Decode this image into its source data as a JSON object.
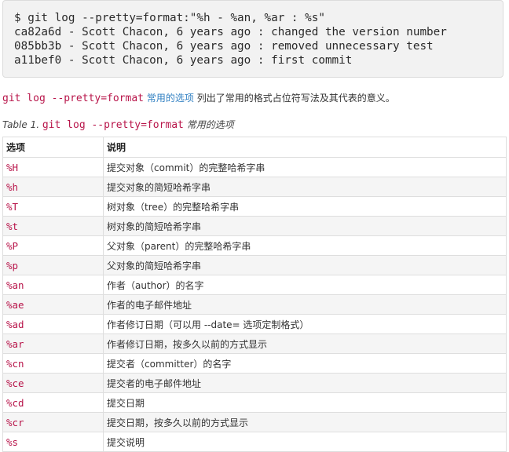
{
  "code_block": {
    "lines": [
      "$ git log --pretty=format:\"%h - %an, %ar : %s\"",
      "ca82a6d - Scott Chacon, 6 years ago : changed the version number",
      "085bb3b - Scott Chacon, 6 years ago : removed unnecessary test",
      "a11bef0 - Scott Chacon, 6 years ago : first commit"
    ]
  },
  "intro": {
    "code": "git log --pretty=format",
    "link": "常用的选项",
    "rest": "列出了常用的格式占位符写法及其代表的意义。"
  },
  "caption": {
    "prefix": "Table 1.",
    "code": "git log --pretty=format",
    "suffix": "常用的选项"
  },
  "table": {
    "headers": [
      "选项",
      "说明"
    ],
    "rows": [
      {
        "option": "%H",
        "desc": "提交对象（commit）的完整哈希字串"
      },
      {
        "option": "%h",
        "desc": "提交对象的简短哈希字串"
      },
      {
        "option": "%T",
        "desc": "树对象（tree）的完整哈希字串"
      },
      {
        "option": "%t",
        "desc": "树对象的简短哈希字串"
      },
      {
        "option": "%P",
        "desc": "父对象（parent）的完整哈希字串"
      },
      {
        "option": "%p",
        "desc": "父对象的简短哈希字串"
      },
      {
        "option": "%an",
        "desc": "作者（author）的名字"
      },
      {
        "option": "%ae",
        "desc": "作者的电子邮件地址"
      },
      {
        "option": "%ad",
        "desc": "作者修订日期（可以用 --date= 选项定制格式）"
      },
      {
        "option": "%ar",
        "desc": "作者修订日期，按多久以前的方式显示"
      },
      {
        "option": "%cn",
        "desc": "提交者（committer）的名字"
      },
      {
        "option": "%ce",
        "desc": "提交者的电子邮件地址"
      },
      {
        "option": "%cd",
        "desc": "提交日期"
      },
      {
        "option": "%cr",
        "desc": "提交日期，按多久以前的方式显示"
      },
      {
        "option": "%s",
        "desc": "提交说明"
      }
    ]
  }
}
